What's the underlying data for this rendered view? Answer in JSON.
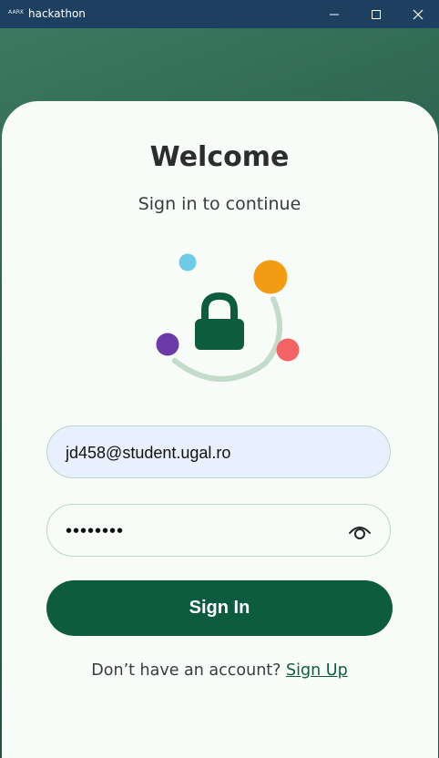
{
  "window": {
    "app_icon_text": "AARK",
    "title": "hackathon"
  },
  "login": {
    "title": "Welcome",
    "subtitle": "Sign in to continue",
    "email_value": "jd458@student.ugal.ro",
    "password_masked": "••••••••",
    "signin_label": "Sign In",
    "no_account_text": "Don’t have an account?",
    "signup_label": "Sign Up"
  },
  "colors": {
    "primary": "#0d5c40",
    "dot_blue": "#6ecbe6",
    "dot_orange": "#f29b13",
    "dot_purple": "#6a3aa8",
    "dot_red": "#f36366"
  },
  "icons": [
    "minimize-icon",
    "maximize-icon",
    "close-icon",
    "lock-icon",
    "eye-icon"
  ]
}
